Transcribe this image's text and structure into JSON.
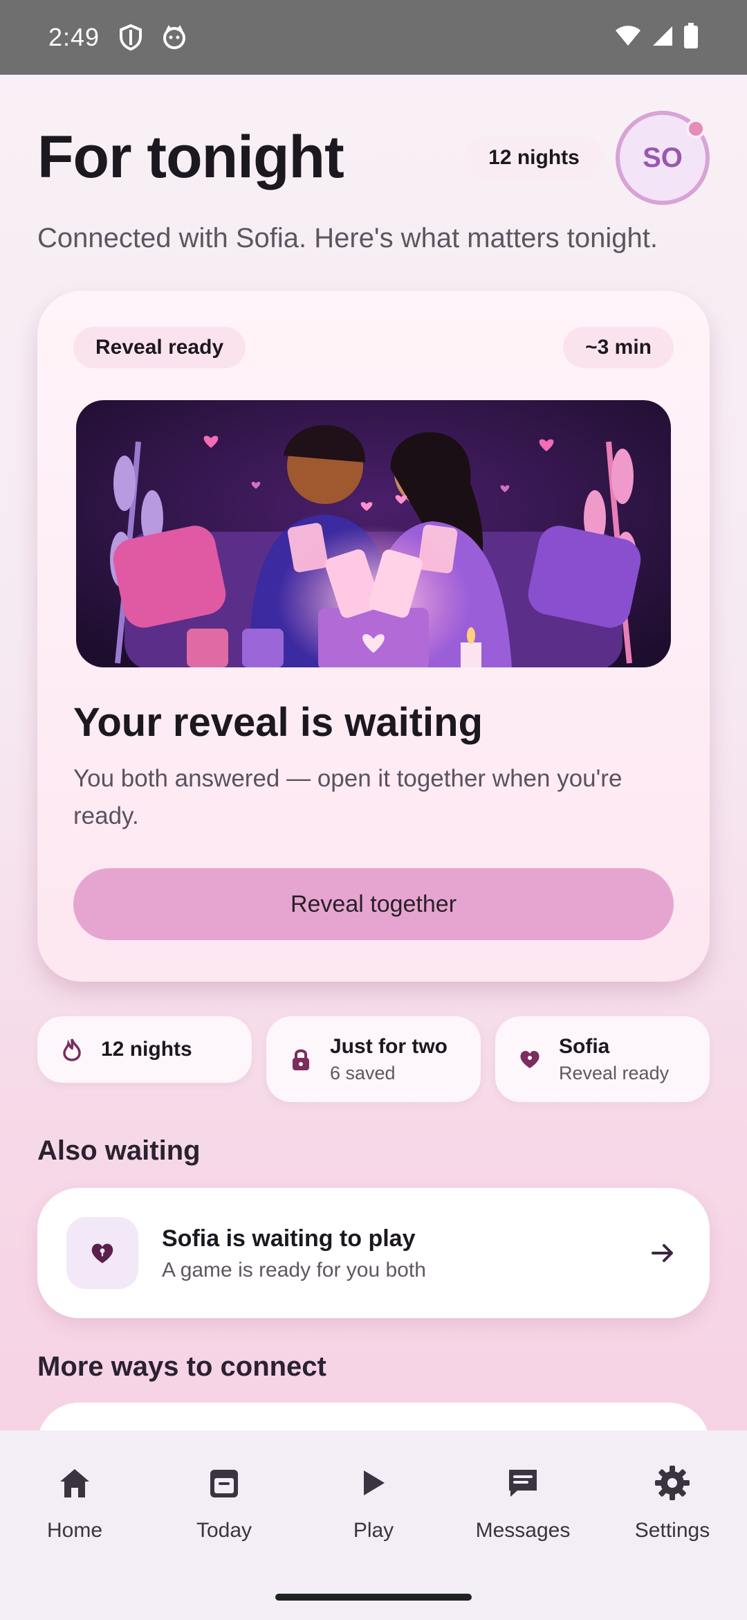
{
  "status_bar": {
    "time": "2:49"
  },
  "header": {
    "title": "For tonight",
    "streak_pill": "12 nights",
    "avatar_initials": "SO",
    "subtitle": "Connected with Sofia. Here's what matters tonight."
  },
  "hero": {
    "chip_left": "Reveal ready",
    "chip_right": "~3 min",
    "heading": "Your reveal is waiting",
    "body": "You both answered — open it together when you're ready.",
    "button_label": "Reveal together"
  },
  "stats": [
    {
      "title": "12 nights",
      "sub": "",
      "icon": "flame-icon"
    },
    {
      "title": "Just for two",
      "sub": "6 saved",
      "icon": "lock-icon"
    },
    {
      "title": "Sofia",
      "sub": "Reveal ready",
      "icon": "heart-icon"
    }
  ],
  "also_waiting": {
    "section_title": "Also waiting",
    "card_title": "Sofia is waiting to play",
    "card_sub": "A game is ready for you both",
    "icon": "heart-lock-icon"
  },
  "more_ways": {
    "section_title": "More ways to connect"
  },
  "nav": {
    "items": [
      {
        "label": "Home",
        "icon": "home-icon"
      },
      {
        "label": "Today",
        "icon": "calendar-icon"
      },
      {
        "label": "Play",
        "icon": "play-icon"
      },
      {
        "label": "Messages",
        "icon": "messages-icon"
      },
      {
        "label": "Settings",
        "icon": "gear-icon"
      }
    ]
  },
  "colors": {
    "accent": "#e6a5d1",
    "avatar_ring": "#d8a3d6",
    "icon_purple": "#7a2e5e"
  }
}
